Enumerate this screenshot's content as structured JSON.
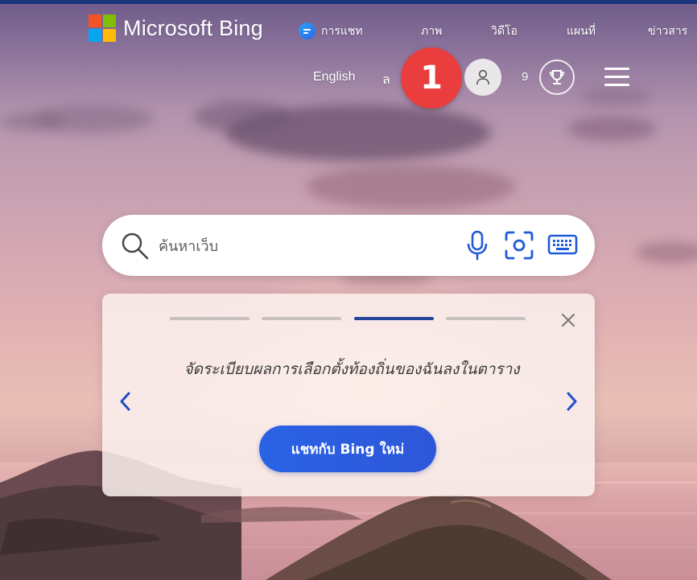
{
  "brand": {
    "name": "Microsoft Bing"
  },
  "nav": {
    "items": [
      {
        "label": "การแชท",
        "icon": "chat-icon"
      },
      {
        "label": "ภาพ"
      },
      {
        "label": "วิดีโอ"
      },
      {
        "label": "แผนที่"
      },
      {
        "label": "ข่าวสาร"
      }
    ]
  },
  "header": {
    "language_link": "English",
    "language_link_partial": "ล",
    "step_badge": "1",
    "points": "9",
    "avatar_icon": "user-icon",
    "rewards_icon": "trophy-icon",
    "menu_icon": "hamburger-menu-icon"
  },
  "search": {
    "placeholder": "ค้นหาเว็บ",
    "value": "",
    "icons": [
      "search-icon",
      "microphone-icon",
      "visual-search-icon",
      "keyboard-icon"
    ]
  },
  "card": {
    "pages": 4,
    "active_page": 3,
    "prompt": "จัดระเบียบผลการเลือกตั้งท้องถิ่นของฉันลงในตาราง",
    "cta_label": "แชทกับ Bing ใหม่"
  },
  "colors": {
    "top_strip": "#19367a",
    "badge": "#ea3d3d",
    "cta": "#2a63e5",
    "active_dot": "#24439a"
  }
}
